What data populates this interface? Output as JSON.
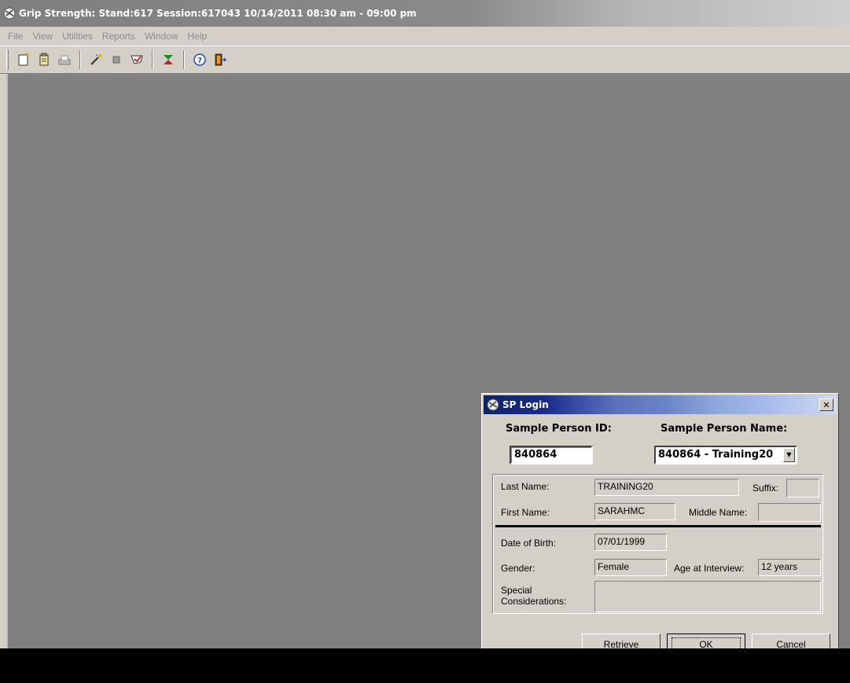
{
  "window": {
    "title": "Grip Strength: Stand:617 Session:617043 10/14/2011 08:30 am - 09:00 pm",
    "icon": "app-globe-icon"
  },
  "menu": [
    "File",
    "View",
    "Utilities",
    "Reports",
    "Window",
    "Help"
  ],
  "toolbar": {
    "buttons": [
      "new-document-icon",
      "clipboard-icon",
      "print-icon",
      "magic-wand-icon",
      "stop-icon",
      "checklist-icon",
      "sort-icon",
      "help-icon",
      "exit-door-icon"
    ]
  },
  "dialog": {
    "title": "SP Login",
    "close_label": "✕",
    "sp_id_label": "Sample Person ID:",
    "sp_name_label": "Sample Person Name:",
    "sp_id_value": "840864",
    "sp_name_value": "840864 - Training20",
    "fields": {
      "last_name_label": "Last Name:",
      "last_name_value": "TRAINING20",
      "suffix_label": "Suffix:",
      "suffix_value": "",
      "first_name_label": "First Name:",
      "first_name_value": "SARAHMC",
      "middle_name_label": "Middle Name:",
      "middle_name_value": "",
      "dob_label": "Date of Birth:",
      "dob_value": "07/01/1999",
      "gender_label": "Gender:",
      "gender_value": "Female",
      "age_label": "Age at Interview:",
      "age_value": "12 years",
      "special_label_line1": "Special",
      "special_label_line2": "Considerations:",
      "special_value": ""
    },
    "buttons": {
      "retrieve": "Retrieve",
      "ok": "OK",
      "cancel": "Cancel"
    }
  },
  "colors": {
    "face": "#d4d0c8",
    "workspace": "#808080",
    "dialog_title_start": "#0a246a"
  }
}
